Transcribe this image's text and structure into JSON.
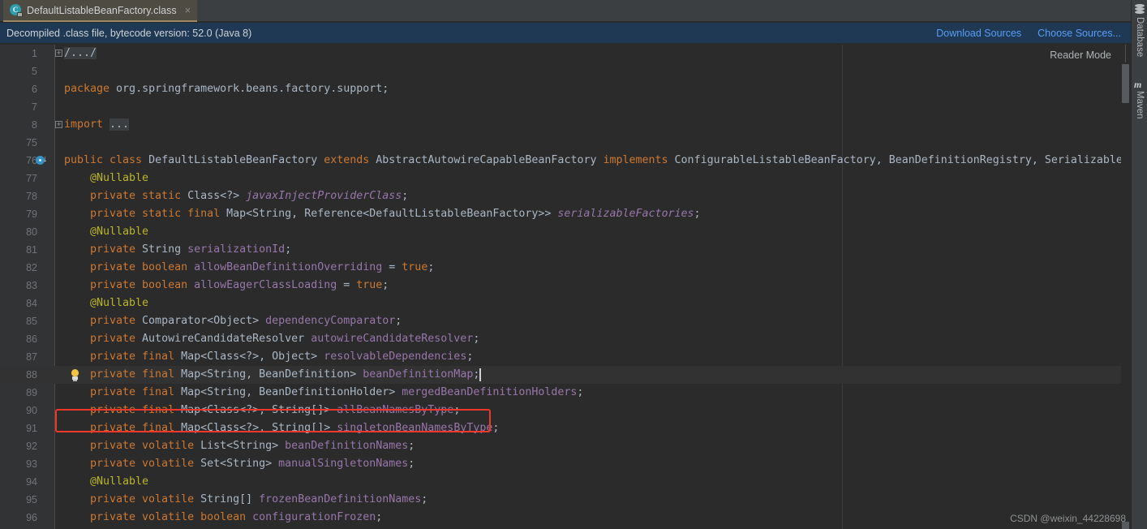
{
  "window": {
    "tab": {
      "label": "DefaultListableBeanFactory.class",
      "icon": "decompiled-class-icon",
      "icon_letter": "C",
      "close_label": "×"
    }
  },
  "notification": {
    "message": "Decompiled .class file, bytecode version: 52.0 (Java 8)",
    "actions": [
      {
        "label": "Download Sources"
      },
      {
        "label": "Choose Sources..."
      }
    ],
    "background": "#1f3853",
    "link_color": "#589df6"
  },
  "editor": {
    "reader_mode_label": "Reader Mode",
    "colors": {
      "background": "#2b2b2b",
      "gutter": "#313335",
      "keyword": "#cc7832",
      "field": "#9876aa",
      "annotation": "#bbb529",
      "text": "#a9b7c6",
      "caret_row": "#323232",
      "highlight_box": "#f0372a"
    },
    "lines": [
      {
        "num": "1",
        "fold": "+",
        "caret": false,
        "tokens": [
          {
            "t": "/.../",
            "c": "fold-ph"
          }
        ]
      },
      {
        "num": "5",
        "caret": false,
        "tokens": []
      },
      {
        "num": "6",
        "caret": false,
        "tokens": [
          {
            "t": "package ",
            "c": "kw"
          },
          {
            "t": "org.springframework.beans.factory.support;",
            "c": "txt"
          }
        ]
      },
      {
        "num": "7",
        "caret": false,
        "tokens": []
      },
      {
        "num": "8",
        "fold": "+",
        "caret": false,
        "tokens": [
          {
            "t": "import ",
            "c": "kw"
          },
          {
            "t": "...",
            "c": "fold-ph"
          }
        ]
      },
      {
        "num": "75",
        "caret": false,
        "tokens": []
      },
      {
        "num": "76",
        "caret": false,
        "gutter_icon": "implemented-methods-icon",
        "tokens": [
          {
            "t": "public class ",
            "c": "kw"
          },
          {
            "t": "DefaultListableBeanFactory ",
            "c": "txt"
          },
          {
            "t": "extends ",
            "c": "kw"
          },
          {
            "t": "AbstractAutowireCapableBeanFactory ",
            "c": "txt"
          },
          {
            "t": "implements ",
            "c": "kw"
          },
          {
            "t": "ConfigurableListableBeanFactory, BeanDefinitionRegistry, Serializable {",
            "c": "txt"
          }
        ]
      },
      {
        "num": "77",
        "caret": false,
        "indent": 4,
        "tokens": [
          {
            "t": "@Nullable",
            "c": "ann"
          }
        ]
      },
      {
        "num": "78",
        "caret": false,
        "indent": 4,
        "tokens": [
          {
            "t": "private static ",
            "c": "kw"
          },
          {
            "t": "Class<?> ",
            "c": "txt"
          },
          {
            "t": "javaxInjectProviderClass",
            "c": "sfld"
          },
          {
            "t": ";",
            "c": "txt"
          }
        ]
      },
      {
        "num": "79",
        "caret": false,
        "indent": 4,
        "tokens": [
          {
            "t": "private static final ",
            "c": "kw"
          },
          {
            "t": "Map<String, Reference<DefaultListableBeanFactory>> ",
            "c": "txt"
          },
          {
            "t": "serializableFactories",
            "c": "sfld"
          },
          {
            "t": ";",
            "c": "txt"
          }
        ]
      },
      {
        "num": "80",
        "caret": false,
        "indent": 4,
        "tokens": [
          {
            "t": "@Nullable",
            "c": "ann"
          }
        ]
      },
      {
        "num": "81",
        "caret": false,
        "indent": 4,
        "tokens": [
          {
            "t": "private ",
            "c": "kw"
          },
          {
            "t": "String ",
            "c": "txt"
          },
          {
            "t": "serializationId",
            "c": "fld"
          },
          {
            "t": ";",
            "c": "txt"
          }
        ]
      },
      {
        "num": "82",
        "caret": false,
        "indent": 4,
        "tokens": [
          {
            "t": "private boolean ",
            "c": "kw"
          },
          {
            "t": "allowBeanDefinitionOverriding",
            "c": "fld"
          },
          {
            "t": " = ",
            "c": "txt"
          },
          {
            "t": "true",
            "c": "kw"
          },
          {
            "t": ";",
            "c": "txt"
          }
        ]
      },
      {
        "num": "83",
        "caret": false,
        "indent": 4,
        "tokens": [
          {
            "t": "private boolean ",
            "c": "kw"
          },
          {
            "t": "allowEagerClassLoading",
            "c": "fld"
          },
          {
            "t": " = ",
            "c": "txt"
          },
          {
            "t": "true",
            "c": "kw"
          },
          {
            "t": ";",
            "c": "txt"
          }
        ]
      },
      {
        "num": "84",
        "caret": false,
        "indent": 4,
        "tokens": [
          {
            "t": "@Nullable",
            "c": "ann"
          }
        ]
      },
      {
        "num": "85",
        "caret": false,
        "indent": 4,
        "tokens": [
          {
            "t": "private ",
            "c": "kw"
          },
          {
            "t": "Comparator<Object> ",
            "c": "txt"
          },
          {
            "t": "dependencyComparator",
            "c": "fld"
          },
          {
            "t": ";",
            "c": "txt"
          }
        ]
      },
      {
        "num": "86",
        "caret": false,
        "indent": 4,
        "tokens": [
          {
            "t": "private ",
            "c": "kw"
          },
          {
            "t": "AutowireCandidateResolver ",
            "c": "txt"
          },
          {
            "t": "autowireCandidateResolver",
            "c": "fld"
          },
          {
            "t": ";",
            "c": "txt"
          }
        ]
      },
      {
        "num": "87",
        "caret": false,
        "indent": 4,
        "tokens": [
          {
            "t": "private final ",
            "c": "kw"
          },
          {
            "t": "Map<Class<?>, Object> ",
            "c": "txt"
          },
          {
            "t": "resolvableDependencies",
            "c": "fld"
          },
          {
            "t": ";",
            "c": "txt"
          }
        ]
      },
      {
        "num": "88",
        "caret": true,
        "indent": 4,
        "highlighted": true,
        "intention_icon": "lightbulb-icon",
        "tokens": [
          {
            "t": "private final ",
            "c": "kw"
          },
          {
            "t": "Map<String, BeanDefinition> ",
            "c": "txt"
          },
          {
            "t": "beanDefinitionMap",
            "c": "fld"
          },
          {
            "t": ";",
            "c": "txt"
          }
        ]
      },
      {
        "num": "89",
        "caret": false,
        "indent": 4,
        "tokens": [
          {
            "t": "private final ",
            "c": "kw"
          },
          {
            "t": "Map<String, BeanDefinitionHolder> ",
            "c": "txt"
          },
          {
            "t": "mergedBeanDefinitionHolders",
            "c": "fld"
          },
          {
            "t": ";",
            "c": "txt"
          }
        ]
      },
      {
        "num": "90",
        "caret": false,
        "indent": 4,
        "tokens": [
          {
            "t": "private final ",
            "c": "kw"
          },
          {
            "t": "Map<Class<?>, String[]> ",
            "c": "txt"
          },
          {
            "t": "allBeanNamesByType",
            "c": "fld"
          },
          {
            "t": ";",
            "c": "txt"
          }
        ]
      },
      {
        "num": "91",
        "caret": false,
        "indent": 4,
        "tokens": [
          {
            "t": "private final ",
            "c": "kw"
          },
          {
            "t": "Map<Class<?>, String[]> ",
            "c": "txt"
          },
          {
            "t": "singletonBeanNamesByType",
            "c": "fld"
          },
          {
            "t": ";",
            "c": "txt"
          }
        ]
      },
      {
        "num": "92",
        "caret": false,
        "indent": 4,
        "tokens": [
          {
            "t": "private volatile ",
            "c": "kw"
          },
          {
            "t": "List<String> ",
            "c": "txt"
          },
          {
            "t": "beanDefinitionNames",
            "c": "fld"
          },
          {
            "t": ";",
            "c": "txt"
          }
        ]
      },
      {
        "num": "93",
        "caret": false,
        "indent": 4,
        "tokens": [
          {
            "t": "private volatile ",
            "c": "kw"
          },
          {
            "t": "Set<String> ",
            "c": "txt"
          },
          {
            "t": "manualSingletonNames",
            "c": "fld"
          },
          {
            "t": ";",
            "c": "txt"
          }
        ]
      },
      {
        "num": "94",
        "caret": false,
        "indent": 4,
        "tokens": [
          {
            "t": "@Nullable",
            "c": "ann"
          }
        ]
      },
      {
        "num": "95",
        "caret": false,
        "indent": 4,
        "tokens": [
          {
            "t": "private volatile ",
            "c": "kw"
          },
          {
            "t": "String[] ",
            "c": "txt"
          },
          {
            "t": "frozenBeanDefinitionNames",
            "c": "fld"
          },
          {
            "t": ";",
            "c": "txt"
          }
        ]
      },
      {
        "num": "96",
        "caret": false,
        "indent": 4,
        "tokens": [
          {
            "t": "private volatile boolean ",
            "c": "kw"
          },
          {
            "t": "configurationFrozen",
            "c": "fld"
          },
          {
            "t": ";",
            "c": "txt"
          }
        ]
      }
    ]
  },
  "right_sidebar": {
    "tool_windows": [
      {
        "label": "Database",
        "icon": "database-icon"
      },
      {
        "label": "Maven",
        "icon": "maven-icon"
      }
    ]
  },
  "watermark": {
    "text": "CSDN @weixin_44228698"
  }
}
